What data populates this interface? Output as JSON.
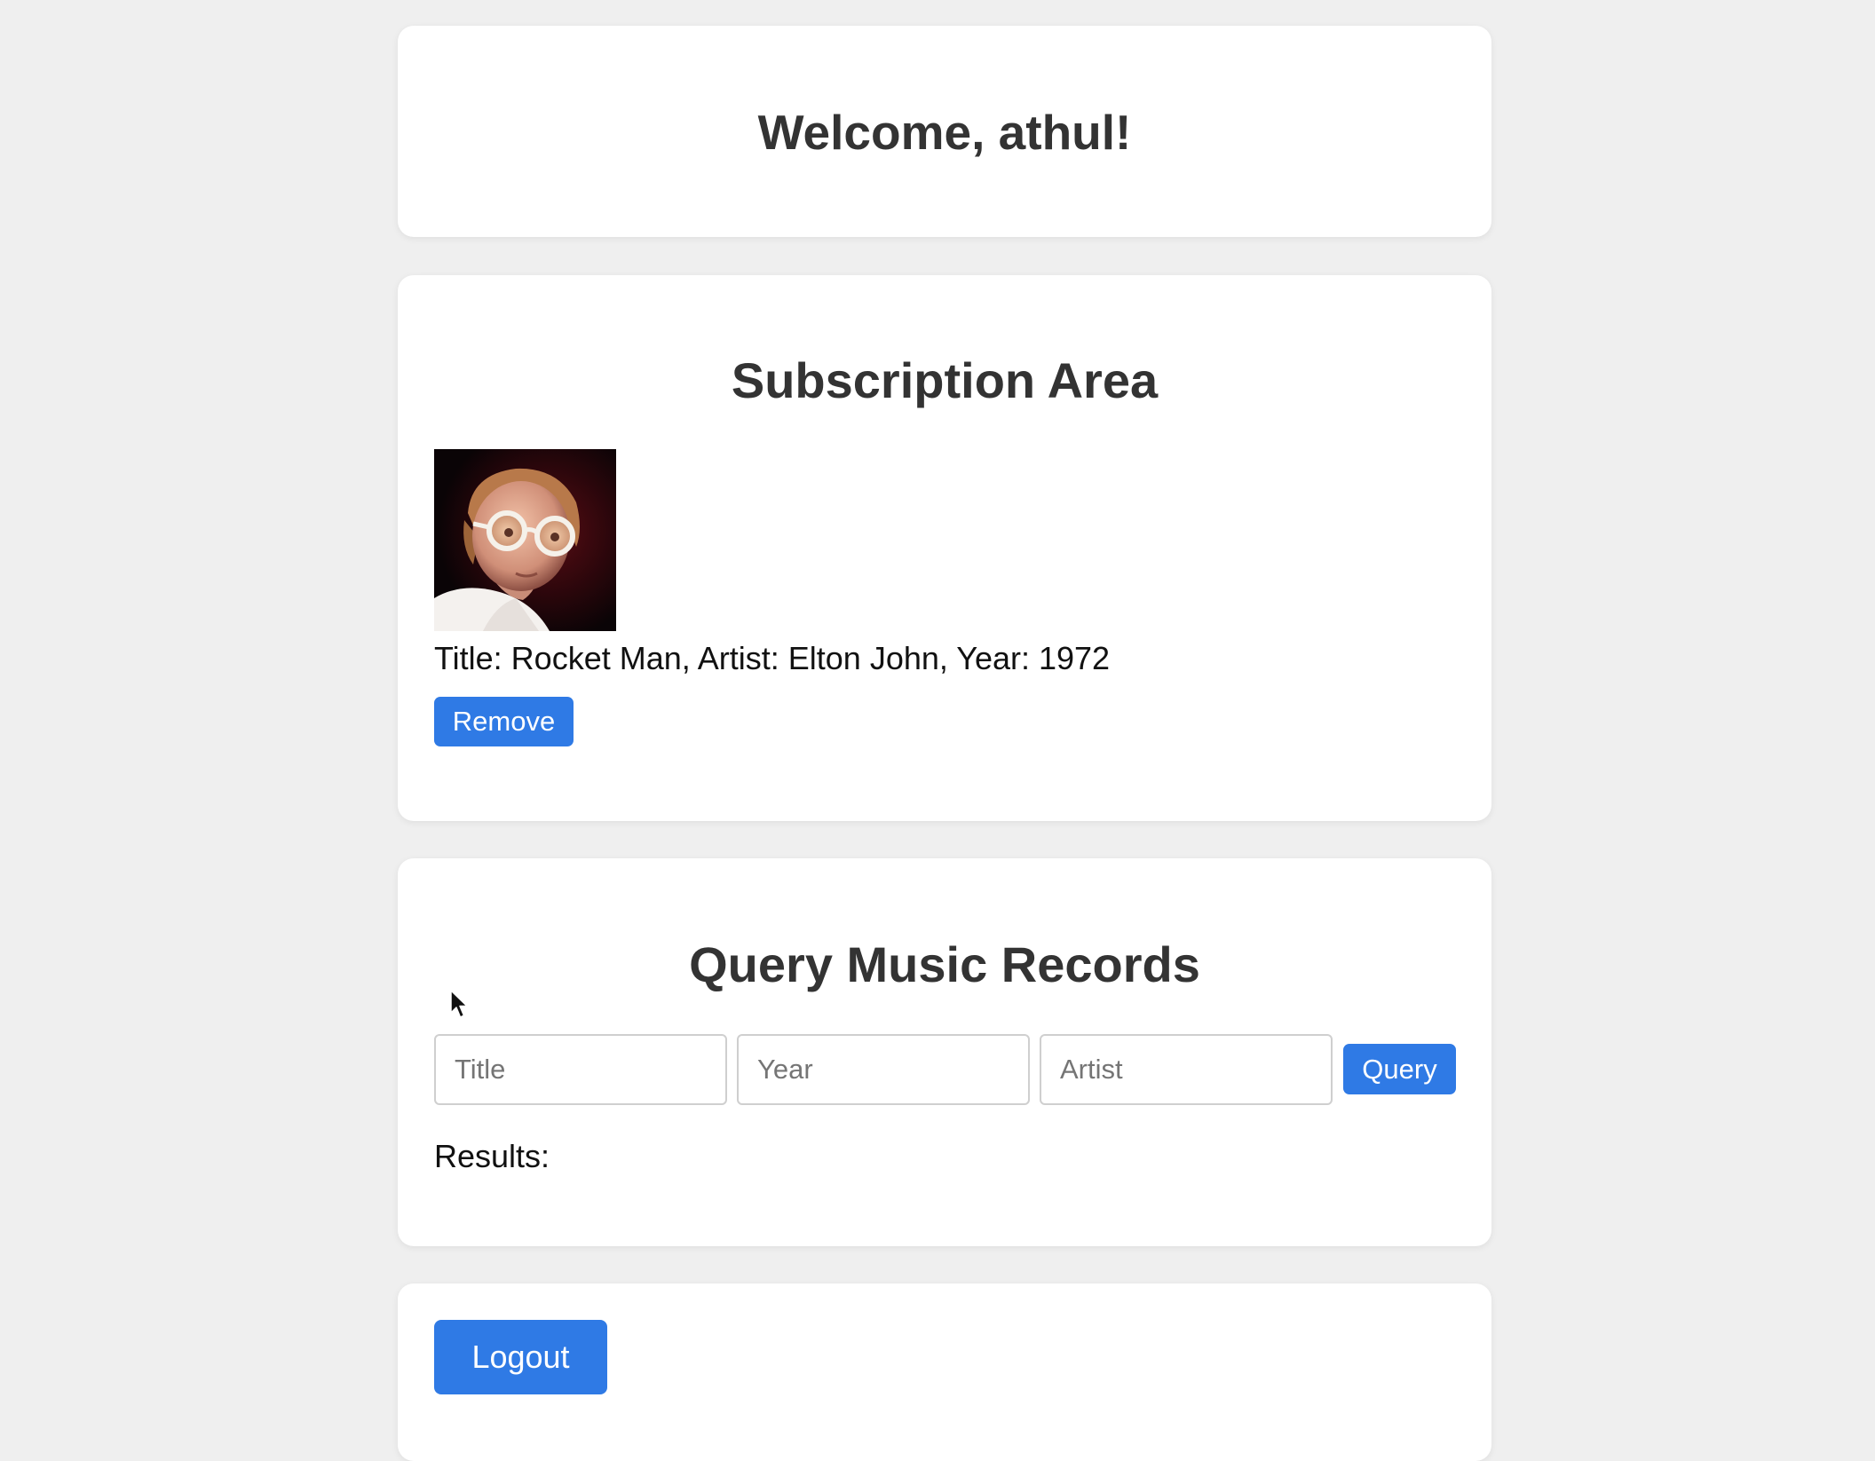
{
  "header": {
    "welcome_text": "Welcome, athul!"
  },
  "subscription": {
    "heading": "Subscription Area",
    "items": [
      {
        "info": "Title: Rocket Man, Artist: Elton John, Year: 1972",
        "remove_label": "Remove"
      }
    ]
  },
  "query": {
    "heading": "Query Music Records",
    "title_placeholder": "Title",
    "year_placeholder": "Year",
    "artist_placeholder": "Artist",
    "button_label": "Query",
    "results_label": "Results:"
  },
  "footer": {
    "logout_label": "Logout"
  },
  "colors": {
    "accent": "#2f7ae5",
    "background": "#efefef",
    "card": "#ffffff",
    "heading": "#333333"
  },
  "icons": {
    "cursor": "mouse-pointer-icon"
  }
}
